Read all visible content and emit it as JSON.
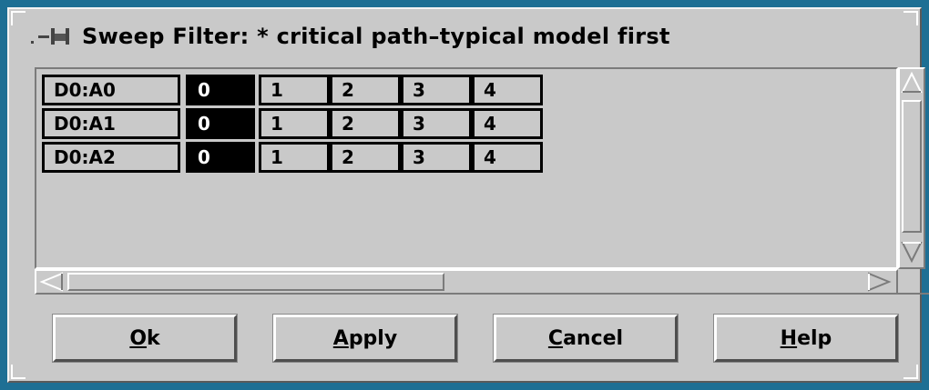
{
  "window": {
    "title": "Sweep Filter: * critical path–typical model first",
    "menu_icon": "window-menu-icon"
  },
  "colors": {
    "desktop": "#1e6f94",
    "window_bg": "#c9c9c9",
    "selected_cell": "#000000"
  },
  "grid": {
    "rows": [
      {
        "name": "D0:A0",
        "values": [
          "0",
          "1",
          "2",
          "3",
          "4"
        ],
        "selected_index": 0
      },
      {
        "name": "D0:A1",
        "values": [
          "0",
          "1",
          "2",
          "3",
          "4"
        ],
        "selected_index": 0
      },
      {
        "name": "D0:A2",
        "values": [
          "0",
          "1",
          "2",
          "3",
          "4"
        ],
        "selected_index": 0
      }
    ]
  },
  "buttons": {
    "ok": {
      "mnemonic": "O",
      "rest": "k"
    },
    "apply": {
      "mnemonic": "A",
      "rest": "pply"
    },
    "cancel": {
      "mnemonic": "C",
      "rest": "ancel"
    },
    "help": {
      "mnemonic": "H",
      "rest": "elp"
    }
  }
}
